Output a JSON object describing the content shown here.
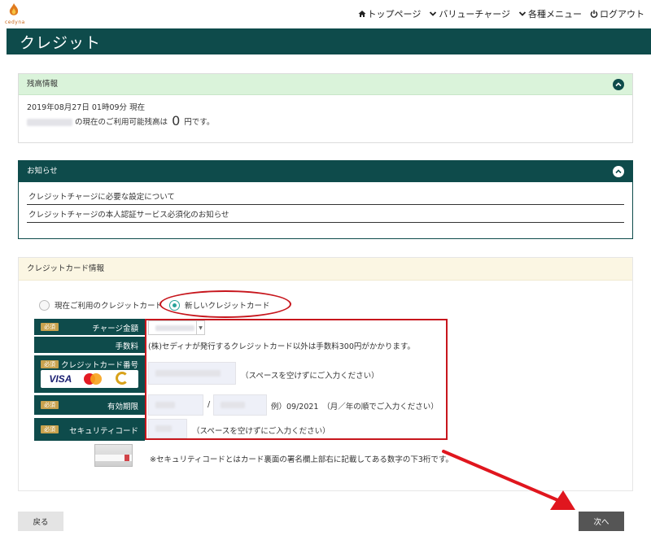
{
  "brand": {
    "name": "cedyna"
  },
  "nav": {
    "items": [
      {
        "label": "トップページ",
        "icon": "home-icon"
      },
      {
        "label": "バリューチャージ",
        "icon": "chevron-down-icon"
      },
      {
        "label": "各種メニュー",
        "icon": "chevron-down-icon"
      },
      {
        "label": "ログアウト",
        "icon": "power-icon"
      }
    ]
  },
  "page": {
    "title": "クレジット"
  },
  "balance": {
    "heading": "残高情報",
    "datetime": "2019年08月27日 01時09分 現在",
    "text_before": "の現在のご利用可能残高は",
    "amount": "0",
    "text_after": "円です。"
  },
  "notice": {
    "heading": "お知らせ",
    "items": [
      "クレジットチャージに必要な設定について",
      "クレジットチャージの本人認証サービス必須化のお知らせ"
    ]
  },
  "card": {
    "heading": "クレジットカード情報",
    "radio_current": "現在ご利用のクレジットカード",
    "radio_new": "新しいクレジットカード",
    "selected": "new",
    "required_badge": "必須",
    "labels": {
      "amount": "チャージ金額",
      "fee": "手数料",
      "number": "クレジットカード番号",
      "expiry": "有効期限",
      "security": "セキュリティコード"
    },
    "brands": [
      "VISA",
      "MasterCard",
      "Cedyna"
    ],
    "fee_note": "(株)セディナが発行するクレジットカード以外は手数料300円がかかります。",
    "number_note": "（スペースを空けずにご入力ください）",
    "expiry_separator": "/",
    "expiry_note": "例）09/2021　（月／年の順でご入力ください）",
    "security_note": "（スペースを空けずにご入力ください）",
    "security_help": "※セキュリティコードとはカード裏面の署名欄上部右に記載してある数字の下3桁です。"
  },
  "buttons": {
    "back": "戻る",
    "next": "次へ"
  },
  "colors": {
    "header": "#0e4b4b",
    "balance_head": "#daf3da",
    "card_head": "#fbf6e3",
    "highlight": "#c7161d",
    "required": "#c8a24e",
    "next_button": "#555555"
  }
}
